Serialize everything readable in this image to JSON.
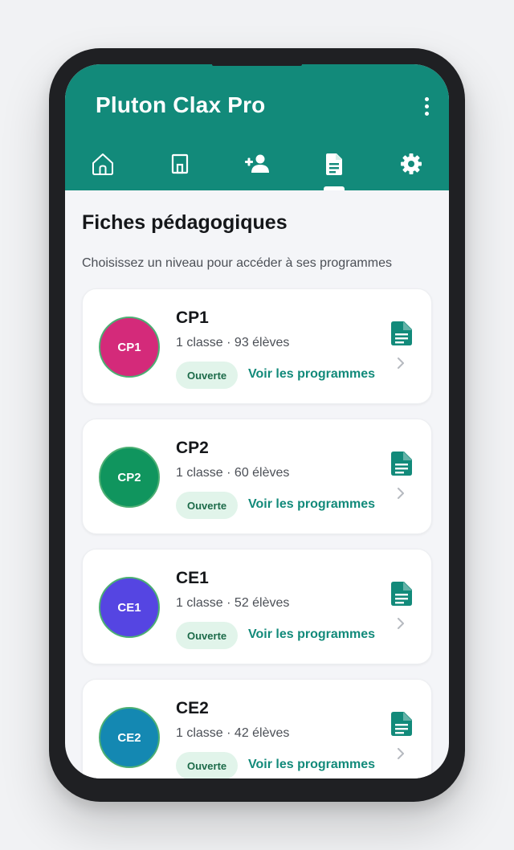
{
  "app": {
    "title": "Pluton Clax Pro",
    "menu_icon": "more-vertical-icon",
    "accent_color": "#128a7a"
  },
  "tabs": [
    {
      "name": "home",
      "icon": "home-icon",
      "active": false
    },
    {
      "name": "school",
      "icon": "building-icon",
      "active": false
    },
    {
      "name": "add-user",
      "icon": "person-add-icon",
      "active": false
    },
    {
      "name": "documents",
      "icon": "document-icon",
      "active": true
    },
    {
      "name": "settings",
      "icon": "gear-icon",
      "active": false
    }
  ],
  "main": {
    "title": "Fiches pédagogiques",
    "subtitle": "Choisissez un niveau pour accéder à ses programmes",
    "levels": [
      {
        "code": "CP1",
        "title": "CP1",
        "meta": "1 classe · 93 élèves",
        "status": "Ouverte",
        "link": "Voir les programmes",
        "color": "#d42a7a"
      },
      {
        "code": "CP2",
        "title": "CP2",
        "meta": "1 classe · 60 élèves",
        "status": "Ouverte",
        "link": "Voir les programmes",
        "color": "#10955e"
      },
      {
        "code": "CE1",
        "title": "CE1",
        "meta": "1 classe · 52 élèves",
        "status": "Ouverte",
        "link": "Voir les programmes",
        "color": "#5545e2"
      },
      {
        "code": "CE2",
        "title": "CE2",
        "meta": "1 classe · 42 élèves",
        "status": "Ouverte",
        "link": "Voir les programmes",
        "color": "#1488b2"
      }
    ]
  }
}
